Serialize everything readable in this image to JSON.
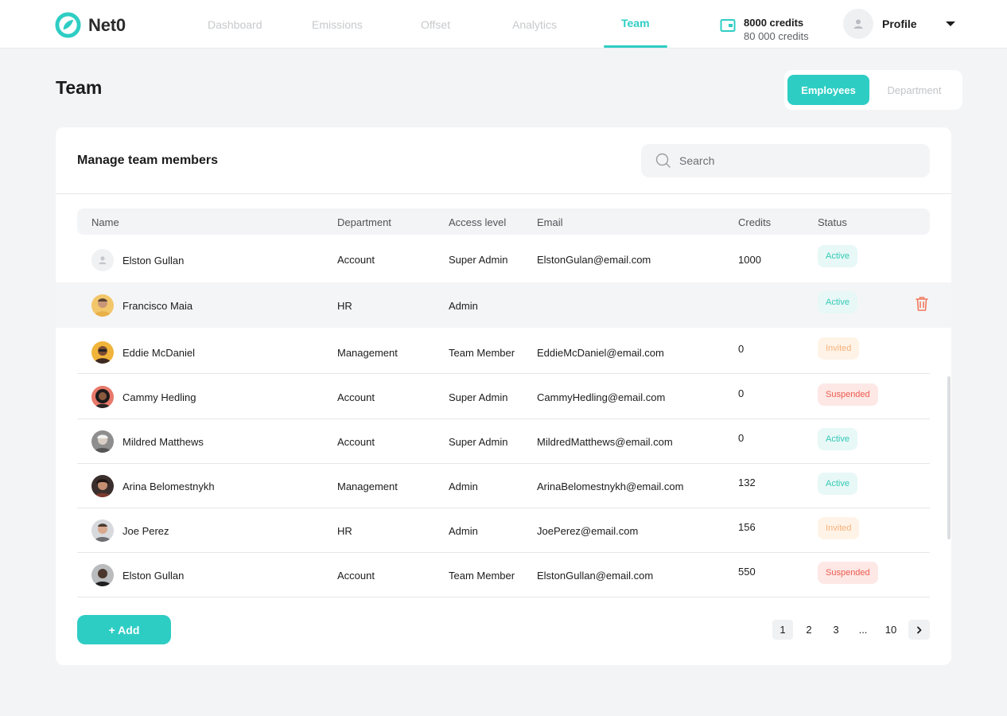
{
  "brand": {
    "name": "Net0",
    "accent": "#2ecdc4"
  },
  "nav": {
    "items": [
      {
        "label": "Dashboard"
      },
      {
        "label": "Emissions"
      },
      {
        "label": "Offset"
      },
      {
        "label": "Analytics"
      },
      {
        "label": "Team",
        "active": true
      }
    ]
  },
  "credits": {
    "icon": "wallet-icon",
    "balance": "8000 credits",
    "total": "80 000 credits"
  },
  "profile": {
    "label": "Profile"
  },
  "page": {
    "title": "Team"
  },
  "view_toggle": {
    "active": "Employees",
    "inactive": "Department"
  },
  "panel": {
    "title": "Manage team members",
    "search_placeholder": "Search"
  },
  "table": {
    "columns": [
      "Name",
      "Department",
      "Access level",
      "Email",
      "Credits",
      "Status"
    ],
    "rows": [
      {
        "name": "Elston Gullan",
        "department": "Account",
        "access": "Super Admin",
        "email": "ElstonGulan@email.com",
        "credits": "1000",
        "status": "Active"
      },
      {
        "name": "Francisco Maia",
        "department": "HR",
        "access": "Admin",
        "email": "",
        "credits": "",
        "status": "Active"
      },
      {
        "name": "Eddie McDaniel",
        "department": "Management",
        "access": "Team Member",
        "email": "EddieMcDaniel@email.com",
        "credits": "0",
        "status": "Invited"
      },
      {
        "name": "Cammy Hedling",
        "department": "Account",
        "access": "Super Admin",
        "email": "CammyHedling@email.com",
        "credits": "0",
        "status": "Suspended"
      },
      {
        "name": "Mildred Matthews",
        "department": "Account",
        "access": "Super Admin",
        "email": "MildredMatthews@email.com",
        "credits": "0",
        "status": "Active"
      },
      {
        "name": "Arina Belomestnykh",
        "department": "Management",
        "access": "Admin",
        "email": "ArinaBelomestnykh@email.com",
        "credits": "132",
        "status": "Active"
      },
      {
        "name": "Joe Perez",
        "department": "HR",
        "access": "Admin",
        "email": "JoePerez@email.com",
        "credits": "156",
        "status": "Invited"
      },
      {
        "name": "Elston Gullan",
        "department": "Account",
        "access": "Team Member",
        "email": "ElstonGullan@email.com",
        "credits": "550",
        "status": "Suspended"
      }
    ]
  },
  "actions": {
    "add_label": "+ Add",
    "delete_icon": "trash-icon"
  },
  "pagination": {
    "pages": [
      "1",
      "2",
      "3",
      "...",
      "10"
    ],
    "current": "1",
    "next_icon": "chevron-right-icon"
  },
  "status_colors": {
    "Active": "#35c9b6",
    "Invited": "#f6b17a",
    "Suspended": "#ee5a4e"
  }
}
